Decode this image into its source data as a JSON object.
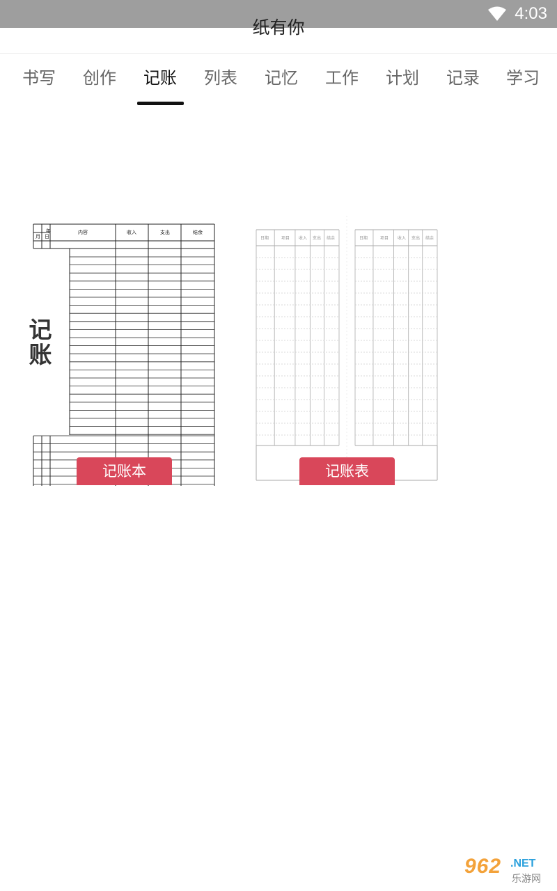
{
  "status_bar": {
    "time": "4:03",
    "wifi_icon": "wifi-icon"
  },
  "app": {
    "title": "纸有你"
  },
  "tabs": [
    {
      "label": "书写"
    },
    {
      "label": "创作"
    },
    {
      "label": "记账",
      "active": true
    },
    {
      "label": "列表"
    },
    {
      "label": "记忆"
    },
    {
      "label": "工作"
    },
    {
      "label": "计划"
    },
    {
      "label": "记录"
    },
    {
      "label": "学习"
    }
  ],
  "cards": [
    {
      "button_label": "记账本",
      "big_label": "记账",
      "table_header": {
        "year": "年",
        "month": "月",
        "day": "日",
        "content": "内容",
        "income": "收入",
        "expense": "支出",
        "balance": "结余"
      }
    },
    {
      "button_label": "记账表",
      "left_headers": [
        "日期",
        "项目",
        "收入",
        "支出",
        "结余"
      ],
      "right_headers": [
        "日期",
        "项目",
        "收入",
        "支出",
        "结余"
      ]
    }
  ],
  "watermark": {
    "number": "962",
    "suffix": ".NET",
    "subtitle": "乐游网"
  },
  "colors": {
    "accent": "#d9475a",
    "status_bar": "#9e9e9e"
  }
}
